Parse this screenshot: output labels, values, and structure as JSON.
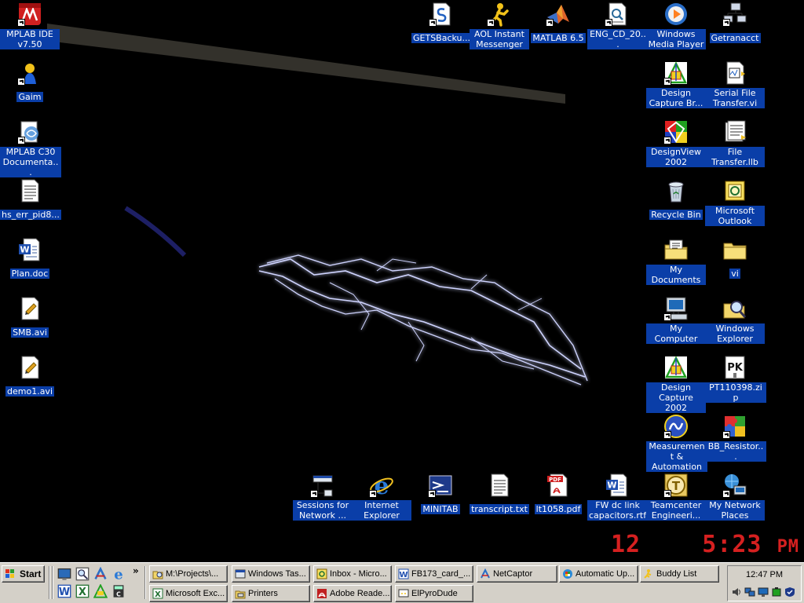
{
  "desktop": {
    "icons": [
      {
        "label": "MPLAB IDE v7.50",
        "icon": "mplab-ide-icon"
      },
      {
        "label": "Gaim",
        "icon": "gaim-icon"
      },
      {
        "label": "MPLAB C30 Documenta...",
        "icon": "mplab-c30-doc-icon"
      },
      {
        "label": "hs_err_pid8...",
        "icon": "text-file-icon"
      },
      {
        "label": "Plan.doc",
        "icon": "word-document-icon"
      },
      {
        "label": "SMB.avi",
        "icon": "avi-file-icon"
      },
      {
        "label": "demo1.avi",
        "icon": "avi-file-icon"
      },
      {
        "label": "GETSBacku...",
        "icon": "backup-icon"
      },
      {
        "label": "AOL Instant Messenger",
        "icon": "aim-icon"
      },
      {
        "label": "MATLAB 6.5",
        "icon": "matlab-icon"
      },
      {
        "label": "ENG_CD_20...",
        "icon": "document-icon"
      },
      {
        "label": "Windows Media Player",
        "icon": "media-player-icon"
      },
      {
        "label": "Getranacct",
        "icon": "network-computer-icon"
      },
      {
        "label": "Design Capture Br...",
        "icon": "design-capture-icon"
      },
      {
        "label": "Serial File Transfer.vi",
        "icon": "labview-vi-icon"
      },
      {
        "label": "DesignView 2002",
        "icon": "designview-icon"
      },
      {
        "label": "File Transfer.llb",
        "icon": "labview-llb-icon"
      },
      {
        "label": "Recycle Bin",
        "icon": "recycle-bin-icon"
      },
      {
        "label": "Microsoft Outlook",
        "icon": "outlook-icon"
      },
      {
        "label": "My Documents",
        "icon": "my-documents-icon"
      },
      {
        "label": "vi",
        "icon": "folder-icon"
      },
      {
        "label": "My Computer",
        "icon": "my-computer-icon"
      },
      {
        "label": "Windows Explorer",
        "icon": "windows-explorer-icon"
      },
      {
        "label": "Design Capture 2002",
        "icon": "design-capture-icon"
      },
      {
        "label": "PT110398.zip",
        "icon": "zip-file-icon"
      },
      {
        "label": "Measurement & Automation",
        "icon": "measurement-automation-icon"
      },
      {
        "label": "BB_Resistor...",
        "icon": "puzzle-icon"
      },
      {
        "label": "Sessions for Network ...",
        "icon": "sessions-icon"
      },
      {
        "label": "Internet Explorer",
        "icon": "internet-explorer-icon"
      },
      {
        "label": "MINITAB",
        "icon": "minitab-icon"
      },
      {
        "label": "transcript.txt",
        "icon": "text-file-icon"
      },
      {
        "label": "lt1058.pdf",
        "icon": "pdf-file-icon"
      },
      {
        "label": "FW dc link capacitors.rtf",
        "icon": "word-document-icon"
      },
      {
        "label": "Teamcenter Engineeri...",
        "icon": "teamcenter-icon"
      },
      {
        "label": "My Network Places",
        "icon": "network-places-icon"
      }
    ],
    "overlay_clock": {
      "day": "12",
      "time": "5:23",
      "ampm": "PM"
    }
  },
  "taskbar": {
    "start_label": "Start",
    "buttons": [
      {
        "label": "M:\\Projects\\...",
        "icon": "folder-search-icon"
      },
      {
        "label": "Windows Tas...",
        "icon": "task-manager-icon"
      },
      {
        "label": "Inbox - Micro...",
        "icon": "outlook-icon"
      },
      {
        "label": "FB173_card_...",
        "icon": "word-icon"
      },
      {
        "label": "NetCaptor",
        "icon": "netcaptor-icon"
      },
      {
        "label": "Automatic Up...",
        "icon": "windows-update-icon"
      },
      {
        "label": "Buddy List",
        "icon": "aim-icon"
      },
      {
        "label": "Microsoft Exc...",
        "icon": "excel-icon"
      },
      {
        "label": "Printers",
        "icon": "printers-icon"
      },
      {
        "label": "Adobe Reade...",
        "icon": "adobe-reader-icon"
      },
      {
        "label": "ElPyroDude",
        "icon": "chat-window-icon"
      }
    ],
    "quick_launch": [
      "desktop-icon",
      "search-icon",
      "netcaptor-icon",
      "internet-explorer-icon",
      "word-icon",
      "excel-icon",
      "design-icon",
      "calculator-icon"
    ],
    "quick_launch_chevron": "»",
    "tray": {
      "clock": "12:47 PM",
      "icons": [
        "volume-icon",
        "network-icon",
        "display-icon",
        "battery-icon",
        "antivirus-icon"
      ]
    }
  },
  "colors": {
    "label_bg": "#0a3ea8",
    "taskbar": "#d4d0c8",
    "overlay_clock": "#d62020",
    "lightning": "#c8d0ff"
  }
}
